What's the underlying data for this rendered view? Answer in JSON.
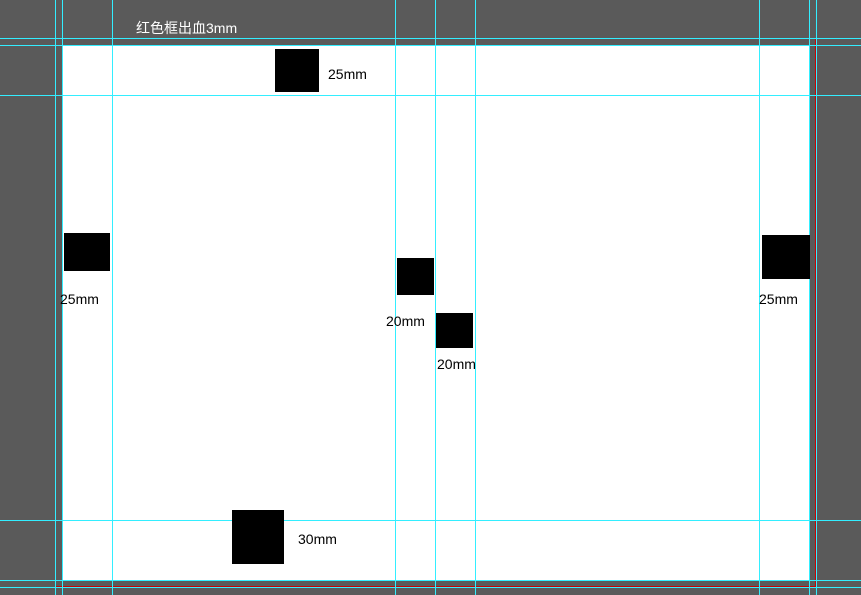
{
  "header_note": "红色框出血3mm",
  "markers": {
    "top_margin_label": "25mm",
    "left_margin_label": "25mm",
    "right_margin_label": "25mm",
    "inner_left_margin_label": "20mm",
    "inner_right_margin_label": "20mm",
    "bottom_margin_label": "30mm"
  }
}
